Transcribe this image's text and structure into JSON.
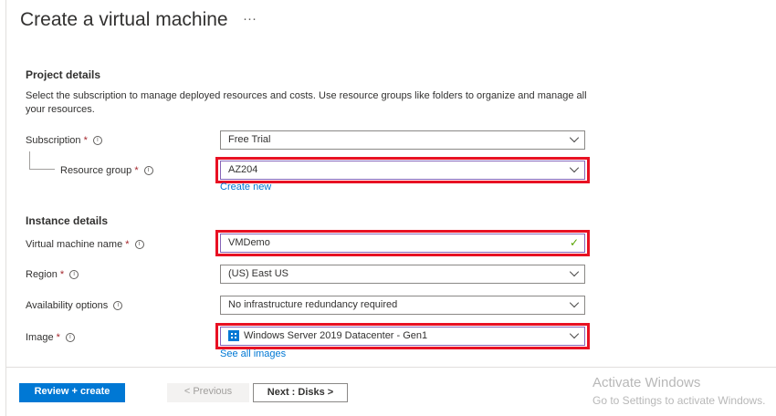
{
  "title": "Create a virtual machine",
  "more": "···",
  "project": {
    "heading": "Project details",
    "description": "Select the subscription to manage deployed resources and costs. Use resource groups like folders to organize and manage all your resources.",
    "subscription": {
      "label": "Subscription",
      "value": "Free Trial"
    },
    "resource_group": {
      "label": "Resource group",
      "value": "AZ204",
      "link": "Create new"
    }
  },
  "instance": {
    "heading": "Instance details",
    "vm_name": {
      "label": "Virtual machine name",
      "value": "VMDemo"
    },
    "region": {
      "label": "Region",
      "value": "(US) East US"
    },
    "availability": {
      "label": "Availability options",
      "value": "No infrastructure redundancy required"
    },
    "image": {
      "label": "Image",
      "value": "Windows Server 2019 Datacenter - Gen1",
      "link": "See all images"
    }
  },
  "required": "*",
  "info": "i",
  "footer": {
    "review": "Review + create",
    "previous": "< Previous",
    "next": "Next : Disks >"
  },
  "watermark": {
    "title": "Activate Windows",
    "sub": "Go to Settings to activate Windows."
  }
}
